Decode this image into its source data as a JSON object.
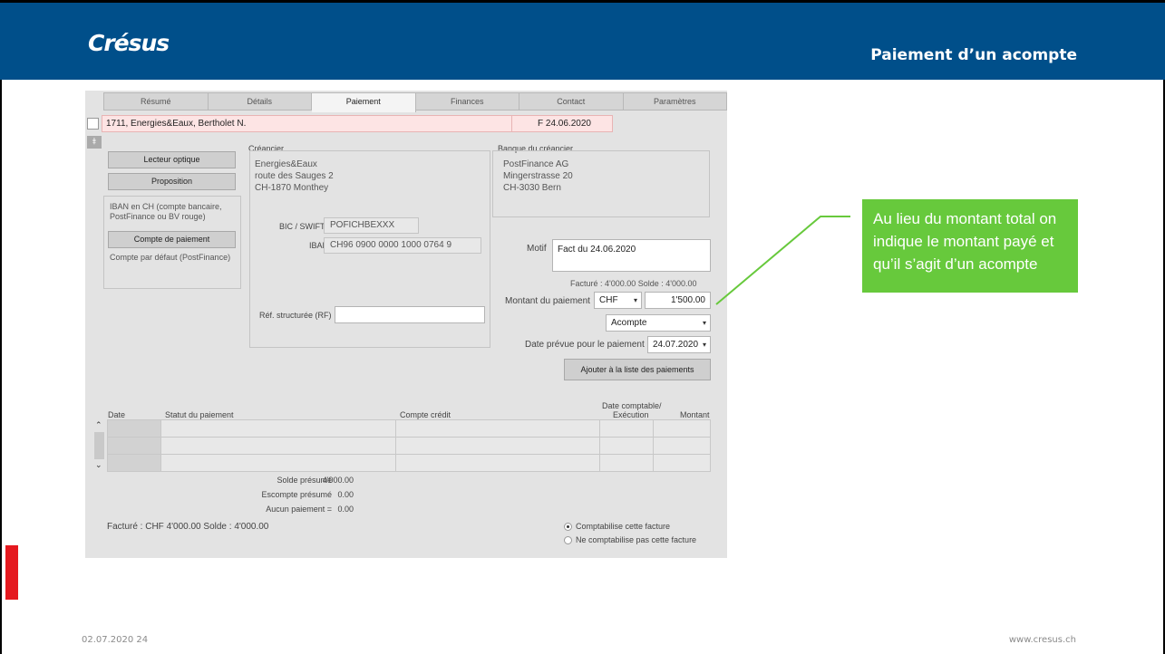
{
  "header": {
    "logo": "Crésus",
    "title": "Paiement d’un acompte"
  },
  "footer": {
    "date_page": "02.07.2020 24",
    "website": "www.cresus.ch"
  },
  "colors": {
    "header_bg": "#004f8a",
    "callout_bg": "#67c93c",
    "accent_red": "#e5191f",
    "row_highlight": "#fde4e4"
  },
  "tabs": [
    "Résumé",
    "Détails",
    "Paiement",
    "Finances",
    "Contact",
    "Paramètres"
  ],
  "active_tab": "Paiement",
  "record": {
    "title": "1711, Energies&Eaux, Bertholet  N.",
    "invoice": "F 24.06.2020"
  },
  "left_panel": {
    "btn_reader": "Lecteur optique",
    "btn_proposal": "Proposition",
    "iban_info": [
      "IBAN en CH (compte bancaire,",
      "PostFinance ou BV rouge)"
    ],
    "btn_account": "Compte de paiement",
    "default_account": "Compte par défaut (PostFinance)"
  },
  "creditor": {
    "label": "Créancier",
    "lines": [
      "Energies&Eaux",
      "route des Sauges 2",
      "CH-1870 Monthey"
    ],
    "bic_label": "BIC / SWIFT",
    "bic": "POFICHBEXXX",
    "iban_label": "IBAN",
    "iban": "CH96 0900 0000 1000 0764 9",
    "ref_label": "Réf. structurée (RF)",
    "ref_value": ""
  },
  "bank": {
    "label": "Banque du créancier",
    "lines": [
      "PostFinance AG",
      "Mingerstrasse 20",
      "CH-3030 Bern"
    ]
  },
  "payment": {
    "motif_label": "Motif",
    "motif": "Fact du 24.06.2020",
    "invoiced_summary": "Facturé : 4'000.00  Solde : 4'000.00",
    "amount_label": "Montant du paiement",
    "currency": "CHF",
    "amount": "1'500.00",
    "type": "Acompte",
    "date_label": "Date prévue pour le paiement",
    "date": "24.07.2020",
    "add_button": "Ajouter à la liste des paiements"
  },
  "table": {
    "col_date": "Date",
    "col_status": "Statut du paiement",
    "col_account": "Compte crédit",
    "col_execution_top": "Date comptable/",
    "col_execution_bottom": "Exécution",
    "col_amount": "Montant"
  },
  "summary": {
    "rows": [
      {
        "label": "Solde présumé",
        "value": "4'000.00"
      },
      {
        "label": "Escompte présumé",
        "value": "0.00"
      },
      {
        "label": "Aucun paiement =",
        "value": "0.00"
      }
    ],
    "footer_text": "Facturé : CHF 4'000.00  Solde : 4'000.00"
  },
  "options": {
    "opt1": "Comptabilise cette facture",
    "opt2": "Ne comptabilise pas cette facture",
    "selected": 1
  },
  "callout": {
    "line1": "Au lieu du montant total on",
    "line2": "indique le montant payé et",
    "line3": "qu’il s’agit d’un acompte"
  }
}
